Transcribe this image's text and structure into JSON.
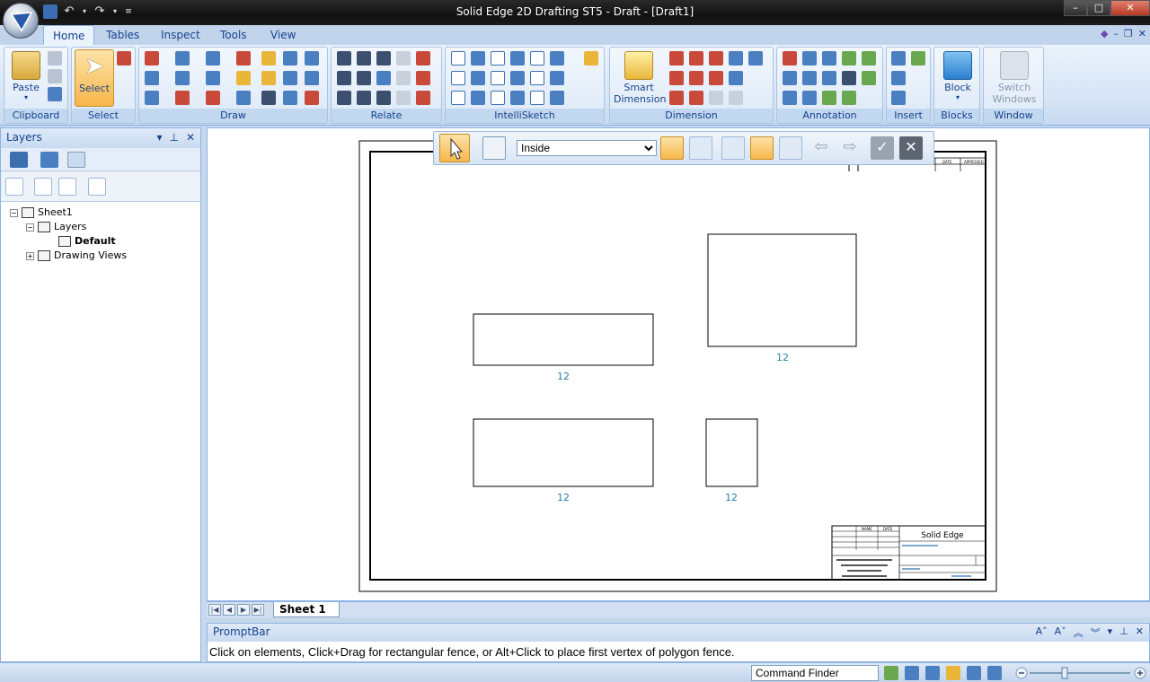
{
  "window": {
    "title": "Solid Edge 2D Drafting ST5 - Draft - [Draft1]"
  },
  "tabs": [
    {
      "label": "Home",
      "active": true
    },
    {
      "label": "Tables",
      "active": false
    },
    {
      "label": "Inspect",
      "active": false
    },
    {
      "label": "Tools",
      "active": false
    },
    {
      "label": "View",
      "active": false
    }
  ],
  "ribbon": {
    "clipboard": {
      "group_label": "Clipboard",
      "paste_label": "Paste"
    },
    "select": {
      "group_label": "Select",
      "select_label": "Select"
    },
    "draw": {
      "group_label": "Draw"
    },
    "relate": {
      "group_label": "Relate"
    },
    "intellisketch": {
      "group_label": "IntelliSketch"
    },
    "dimension": {
      "group_label": "Dimension",
      "smart_label_1": "Smart",
      "smart_label_2": "Dimension"
    },
    "annotation": {
      "group_label": "Annotation"
    },
    "insert": {
      "group_label": "Insert"
    },
    "blocks": {
      "group_label": "Blocks",
      "block_label": "Block"
    },
    "window": {
      "group_label": "Window",
      "switch_label_1": "Switch",
      "switch_label_2": "Windows"
    }
  },
  "layers_panel": {
    "title": "Layers",
    "tree": {
      "sheet": "Sheet1",
      "layers": "Layers",
      "default_layer": "Default",
      "drawing_views": "Drawing Views"
    }
  },
  "select_toolbar": {
    "mode_value": "Inside",
    "mode_options": [
      "Inside"
    ]
  },
  "drawing": {
    "dimensions": [
      "12",
      "12",
      "12",
      "12"
    ],
    "title_block": {
      "brand": "Solid Edge",
      "name_header": "NAME",
      "date_header": "DATE",
      "approved_header": "APPROVED"
    }
  },
  "sheet_tabs": {
    "active": "Sheet 1"
  },
  "prompt_bar": {
    "title": "PromptBar",
    "message": "Click on elements, Click+Drag for rectangular fence, or Alt+Click to place first vertex of polygon fence."
  },
  "status_bar": {
    "command_finder": "Command Finder"
  }
}
